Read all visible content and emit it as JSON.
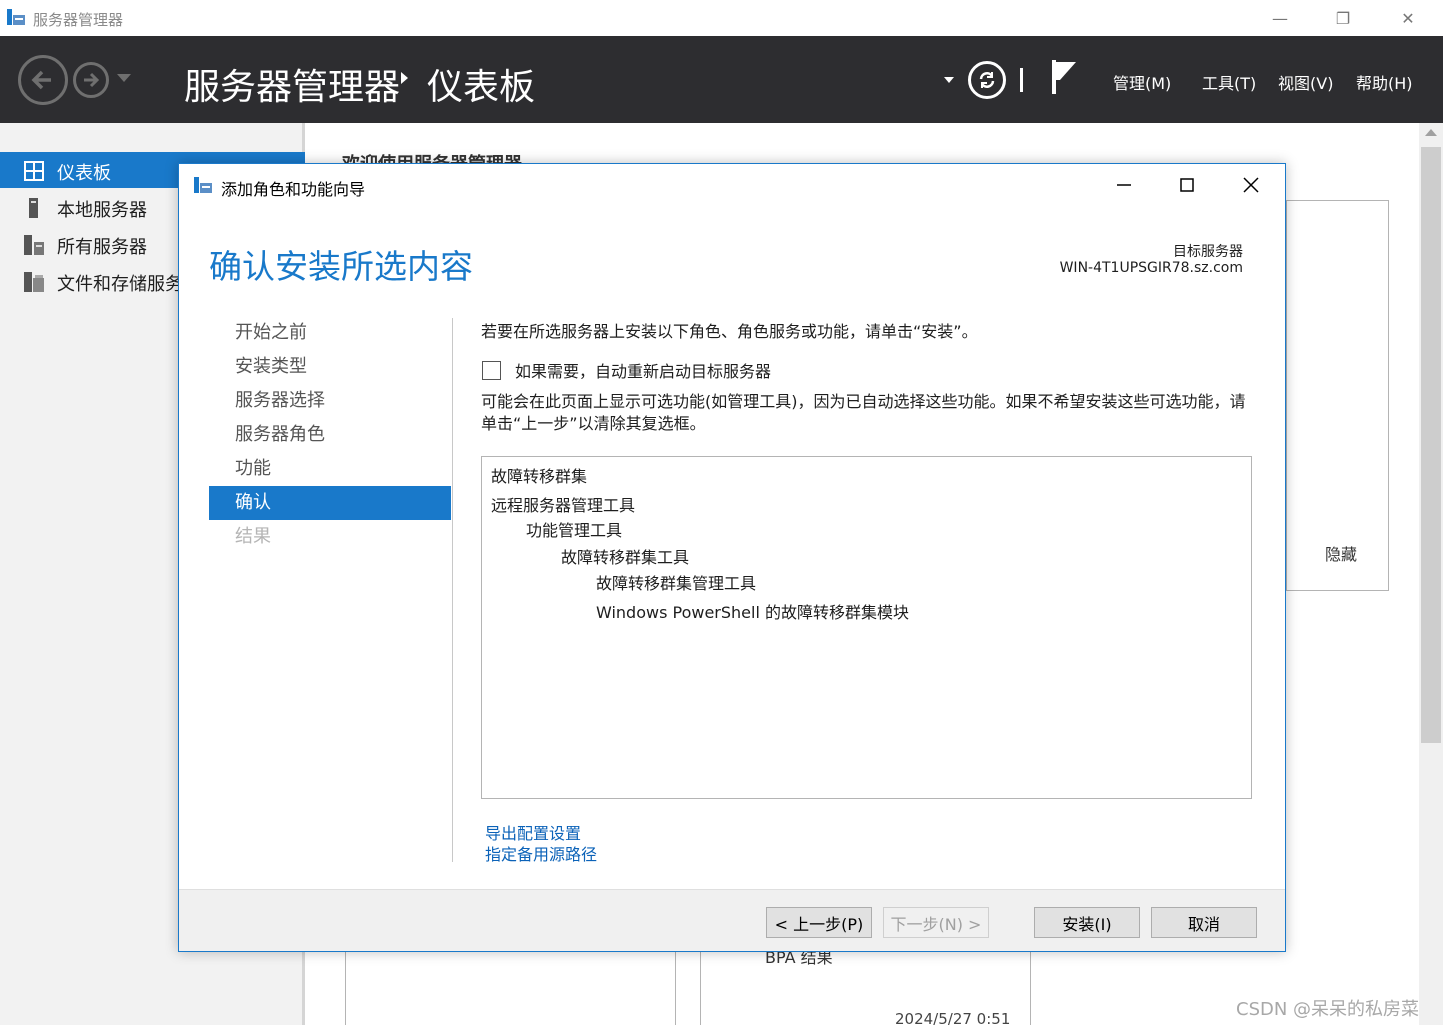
{
  "window": {
    "title": "服务器管理器",
    "minimize": "—",
    "restore": "❐",
    "close": "✕"
  },
  "header": {
    "title": "服务器管理器",
    "subtitle": "仪表板",
    "menus": [
      "管理(M)",
      "工具(T)",
      "视图(V)",
      "帮助(H)"
    ]
  },
  "sidebar": {
    "items": [
      {
        "label": "仪表板",
        "active": true
      },
      {
        "label": "本地服务器"
      },
      {
        "label": "所有服务器"
      },
      {
        "label": "文件和存储服务"
      }
    ]
  },
  "background": {
    "welcome": "欢迎使用服务器管理器",
    "hide": "隐藏",
    "bpa": "BPA 结果",
    "date": "2024/5/27 0:51"
  },
  "watermark": "CSDN @呆呆的私房菜",
  "dialog": {
    "title": "添加角色和功能向导",
    "heading": "确认安装所选内容",
    "target_label": "目标服务器",
    "target_value": "WIN-4T1UPSGIR78.sz.com",
    "steps": [
      "开始之前",
      "安装类型",
      "服务器选择",
      "服务器角色",
      "功能",
      "确认",
      "结果"
    ],
    "active_step": 5,
    "instruction": "若要在所选服务器上安装以下角色、角色服务或功能，请单击“安装”。",
    "restart_checkbox": "如果需要，自动重新启动目标服务器",
    "note": "可能会在此页面上显示可选功能(如管理工具)，因为已自动选择这些功能。如果不希望安装这些可选功能，请单击“上一步”以清除其复选框。",
    "features": [
      {
        "text": "故障转移群集",
        "level": 0
      },
      {
        "text": "远程服务器管理工具",
        "level": 0
      },
      {
        "text": "功能管理工具",
        "level": 1
      },
      {
        "text": "故障转移群集工具",
        "level": 2
      },
      {
        "text": "故障转移群集管理工具",
        "level": 3
      },
      {
        "text": "Windows PowerShell 的故障转移群集模块",
        "level": 3
      }
    ],
    "links": {
      "export": "导出配置设置",
      "alt_source": "指定备用源路径"
    },
    "buttons": {
      "previous": "< 上一步(P)",
      "next": "下一步(N) >",
      "install": "安装(I)",
      "cancel": "取消"
    }
  }
}
